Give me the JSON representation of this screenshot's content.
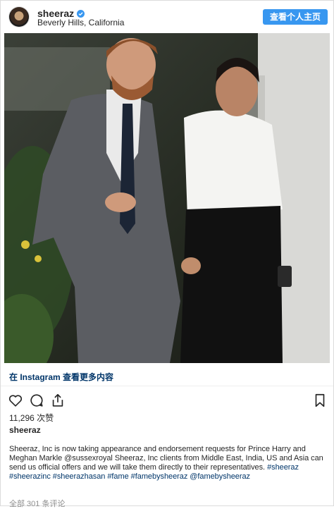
{
  "header": {
    "username": "sheeraz",
    "location": "Beverly Hills, California",
    "view_profile_label": "查看个人主页"
  },
  "icons": {
    "verified": "verified-badge-icon",
    "like": "heart-icon",
    "comment": "comment-icon",
    "share": "share-icon",
    "save": "bookmark-icon"
  },
  "post": {
    "instagram_link": "在 Instagram 查看更多内容",
    "likes": "11,296 次赞",
    "owner": "sheeraz",
    "caption": "Sheeraz, Inc is now taking appearance and endorsement requests for Prince Harry and Meghan Markle @sussexroyal Sheeraz, Inc clients from Middle East, India, US and Asia can send us official offers and we will take them directly to their representatives.",
    "hashtags": "#sheeraz #sheerazinc #sheerazhasan #fame #famebysheeraz @famebysheeraz",
    "comments": "全部 301 条评论"
  },
  "colors": {
    "accent": "#3897f0",
    "link": "#003569",
    "muted": "#8e8e8e"
  }
}
